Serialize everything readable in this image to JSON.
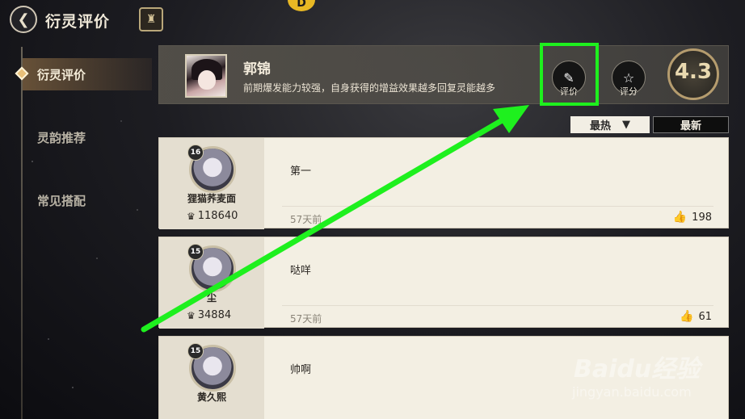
{
  "header": {
    "back_glyph": "❮",
    "title": "衍灵评价",
    "lock_glyph": "♜",
    "coin_glyph": "D"
  },
  "sidebar": {
    "items": [
      {
        "label": "衍灵评价",
        "active": true
      },
      {
        "label": "灵韵推荐",
        "active": false
      },
      {
        "label": "常见搭配",
        "active": false
      }
    ]
  },
  "character": {
    "name": "郭锦",
    "description": "前期爆发能力较强，自身获得的增益效果越多回复灵能越多",
    "rating": "4.3"
  },
  "actions": {
    "review_label": "评价",
    "review_icon": "✎",
    "score_label": "评分",
    "score_icon": "☆"
  },
  "sort": {
    "hot_label": "最热",
    "filter_icon": "▼",
    "new_label": "最新"
  },
  "comments": [
    {
      "level": "16",
      "user": "狸猫荞麦面",
      "power": "118640",
      "text": "第一",
      "time": "57天前",
      "likes": "198"
    },
    {
      "level": "15",
      "user": "尘",
      "power": "34884",
      "text": "哒咩",
      "time": "57天前",
      "likes": "61"
    },
    {
      "level": "15",
      "user": "黄久熙",
      "power": "",
      "text": "帅啊",
      "time": "",
      "likes": ""
    }
  ],
  "watermark": {
    "line1": "Baidu经验",
    "line2": "jingyan.baidu.com"
  },
  "colors": {
    "highlight": "#1ef01e",
    "accent_gold": "#e8c07a"
  }
}
